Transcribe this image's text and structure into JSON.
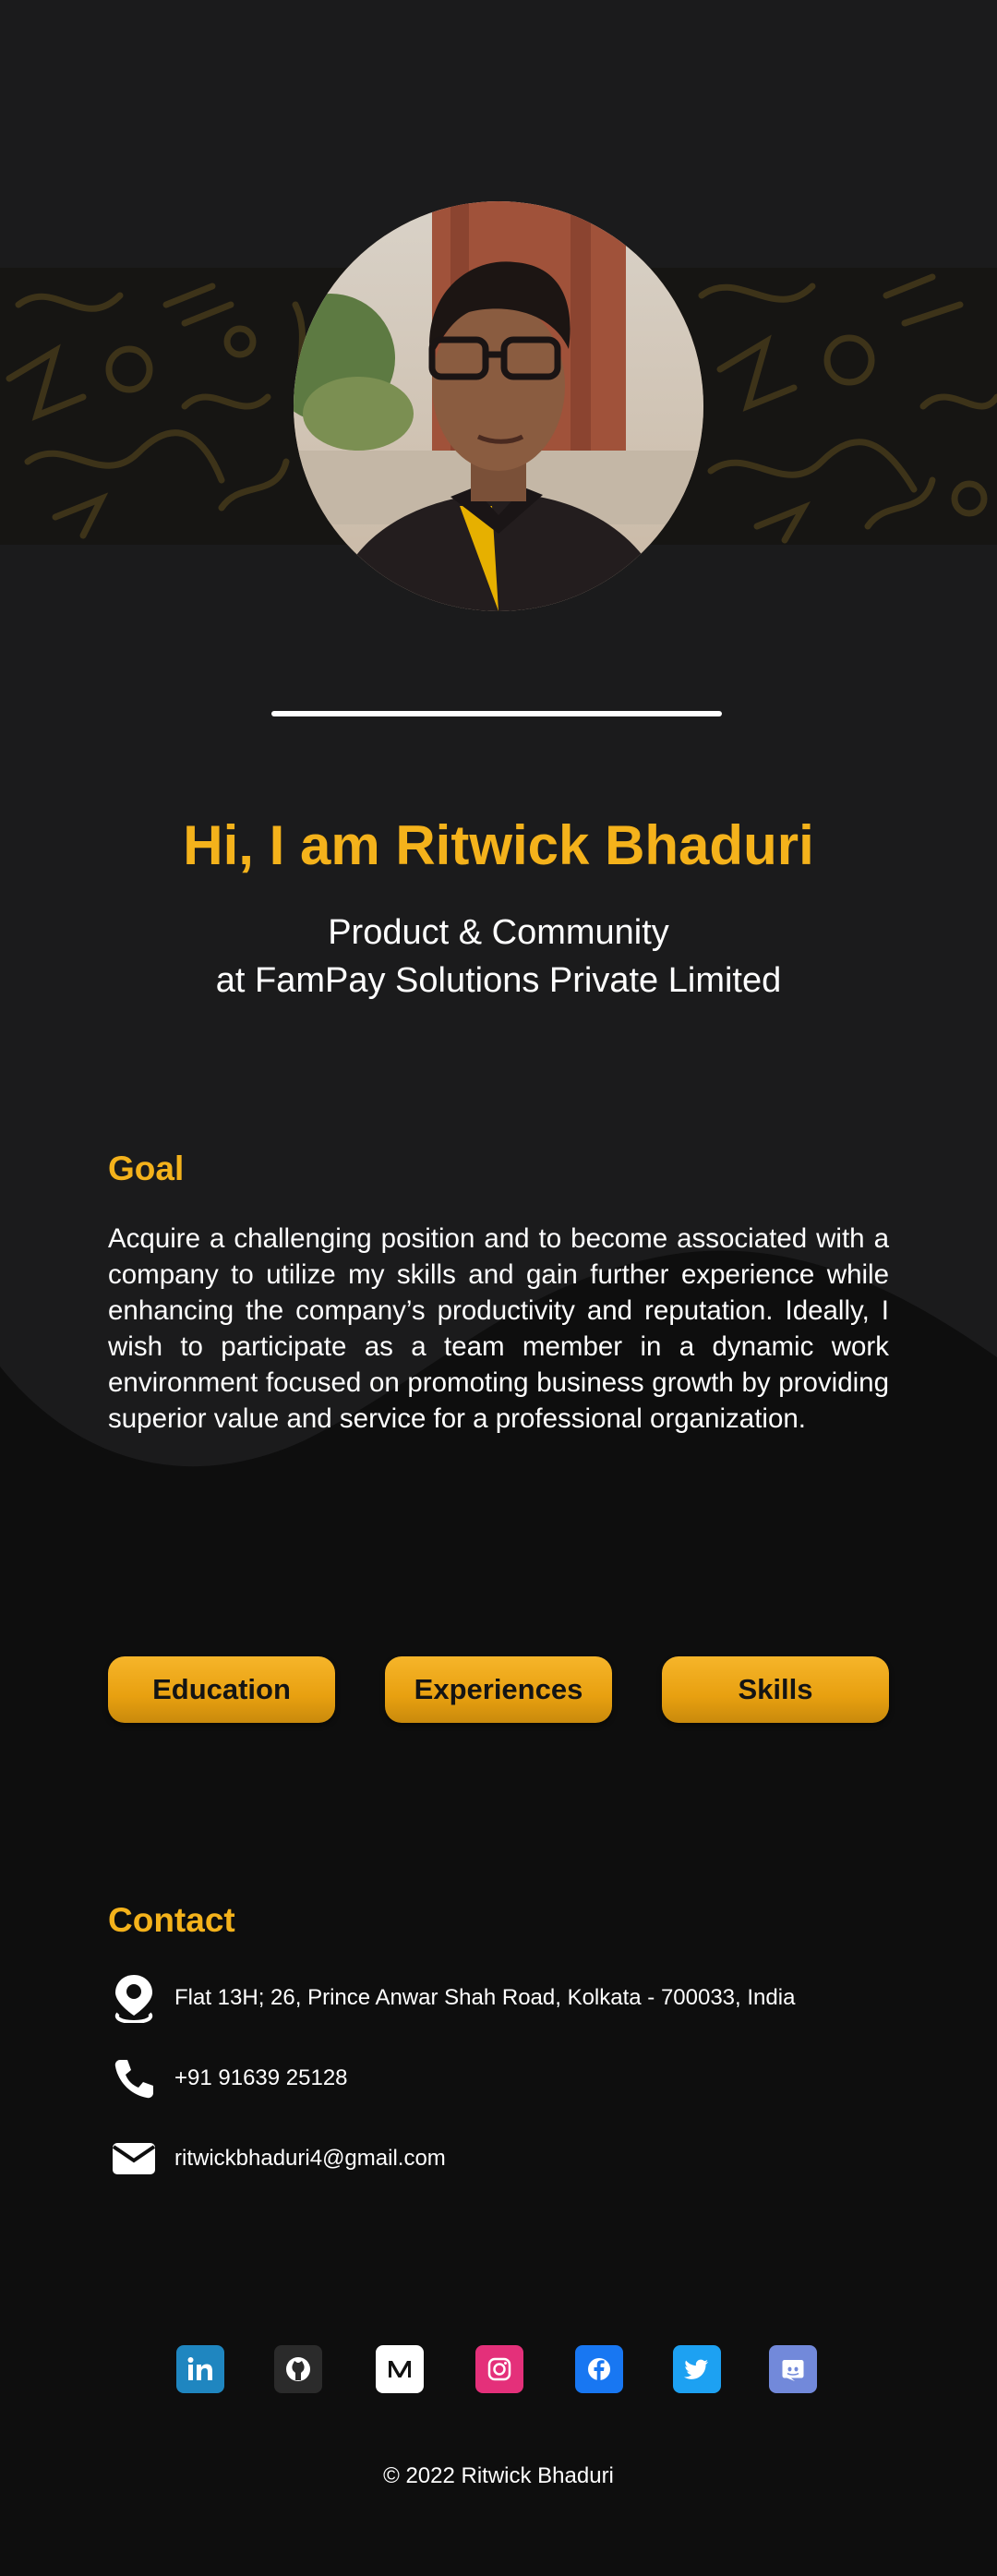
{
  "hero": {
    "title": "Hi, I am Ritwick Bhaduri",
    "role_line1": "Product & Community",
    "role_line2": "at FamPay Solutions Private Limited"
  },
  "goal": {
    "title": "Goal",
    "text": "Acquire a challenging position and to become associated with a company to utilize my skills and gain further experience while enhancing the company’s productivity and reputation. Ideally, I wish to participate as a team member in a dynamic work environment focused on promoting business growth by providing superior value and service for a professional organization."
  },
  "tabs": [
    {
      "label": "Education"
    },
    {
      "label": "Experiences"
    },
    {
      "label": "Skills"
    }
  ],
  "contact": {
    "title": "Contact",
    "address": "Flat 13H; 26, Prince Anwar Shah Road, Kolkata - 700033, India",
    "phone": "+91 91639 25128",
    "email": "ritwickbhaduri4@gmail.com"
  },
  "social": [
    {
      "icon": "linkedin-icon",
      "color": "#1f86c0"
    },
    {
      "icon": "github-icon",
      "color": "#2b2b2b"
    },
    {
      "icon": "medium-icon",
      "color": "#ffffff"
    },
    {
      "icon": "instagram-icon",
      "color": "#e4307a"
    },
    {
      "icon": "facebook-icon",
      "color": "#1877f2"
    },
    {
      "icon": "twitter-icon",
      "color": "#1da1f2"
    },
    {
      "icon": "discord-icon",
      "color": "#7289da"
    }
  ],
  "footer": {
    "copyright": "© 2022 Ritwick Bhaduri"
  },
  "colors": {
    "accent": "#f4b21b",
    "background": "#1b1b1c",
    "lower_background": "#0e0e0e"
  }
}
